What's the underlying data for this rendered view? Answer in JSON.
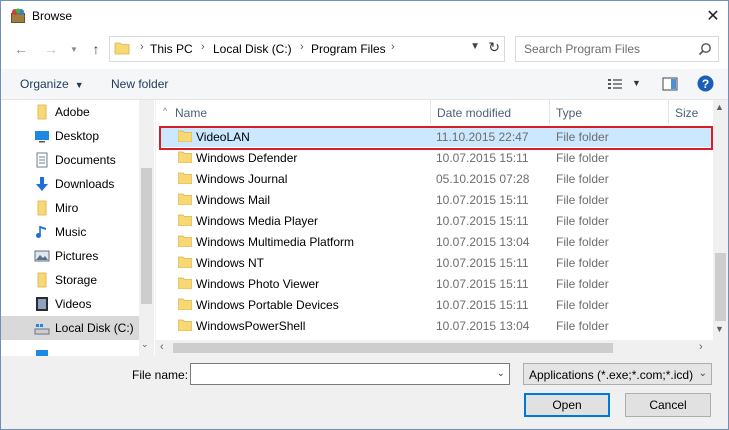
{
  "window": {
    "title": "Browse"
  },
  "address": {
    "crumbs": [
      "This PC",
      "Local Disk (C:)",
      "Program Files"
    ]
  },
  "search": {
    "placeholder": "Search Program Files"
  },
  "toolbar": {
    "organize_label": "Organize",
    "new_folder_label": "New folder"
  },
  "sidebar": {
    "items": [
      {
        "label": "Adobe",
        "icon": "folder-icon"
      },
      {
        "label": "Desktop",
        "icon": "desktop-icon"
      },
      {
        "label": "Documents",
        "icon": "documents-icon"
      },
      {
        "label": "Downloads",
        "icon": "downloads-icon"
      },
      {
        "label": "Miro",
        "icon": "folder-icon"
      },
      {
        "label": "Music",
        "icon": "music-icon"
      },
      {
        "label": "Pictures",
        "icon": "pictures-icon"
      },
      {
        "label": "Storage",
        "icon": "folder-icon"
      },
      {
        "label": "Videos",
        "icon": "videos-icon"
      },
      {
        "label": "Local Disk (C:)",
        "icon": "drive-icon",
        "selected": true
      }
    ]
  },
  "columns": {
    "name": "Name",
    "date": "Date modified",
    "type": "Type",
    "size": "Size"
  },
  "files": [
    {
      "name": "VideoLAN",
      "date": "11.10.2015 22:47",
      "type": "File folder",
      "selected": true
    },
    {
      "name": "Windows Defender",
      "date": "10.07.2015 15:11",
      "type": "File folder"
    },
    {
      "name": "Windows Journal",
      "date": "05.10.2015 07:28",
      "type": "File folder"
    },
    {
      "name": "Windows Mail",
      "date": "10.07.2015 15:11",
      "type": "File folder"
    },
    {
      "name": "Windows Media Player",
      "date": "10.07.2015 15:11",
      "type": "File folder"
    },
    {
      "name": "Windows Multimedia Platform",
      "date": "10.07.2015 13:04",
      "type": "File folder"
    },
    {
      "name": "Windows NT",
      "date": "10.07.2015 15:11",
      "type": "File folder"
    },
    {
      "name": "Windows Photo Viewer",
      "date": "10.07.2015 15:11",
      "type": "File folder"
    },
    {
      "name": "Windows Portable Devices",
      "date": "10.07.2015 15:11",
      "type": "File folder"
    },
    {
      "name": "WindowsPowerShell",
      "date": "10.07.2015 13:04",
      "type": "File folder"
    }
  ],
  "bottom": {
    "file_name_label": "File name:",
    "file_name_value": "",
    "filter": "Applications (*.exe;*.com;*.icd)",
    "open_label": "Open",
    "cancel_label": "Cancel"
  },
  "colors": {
    "selection": "#cce8ff",
    "highlight_border": "#d61f26",
    "accent": "#0078d7",
    "folder": "#f8d775"
  }
}
